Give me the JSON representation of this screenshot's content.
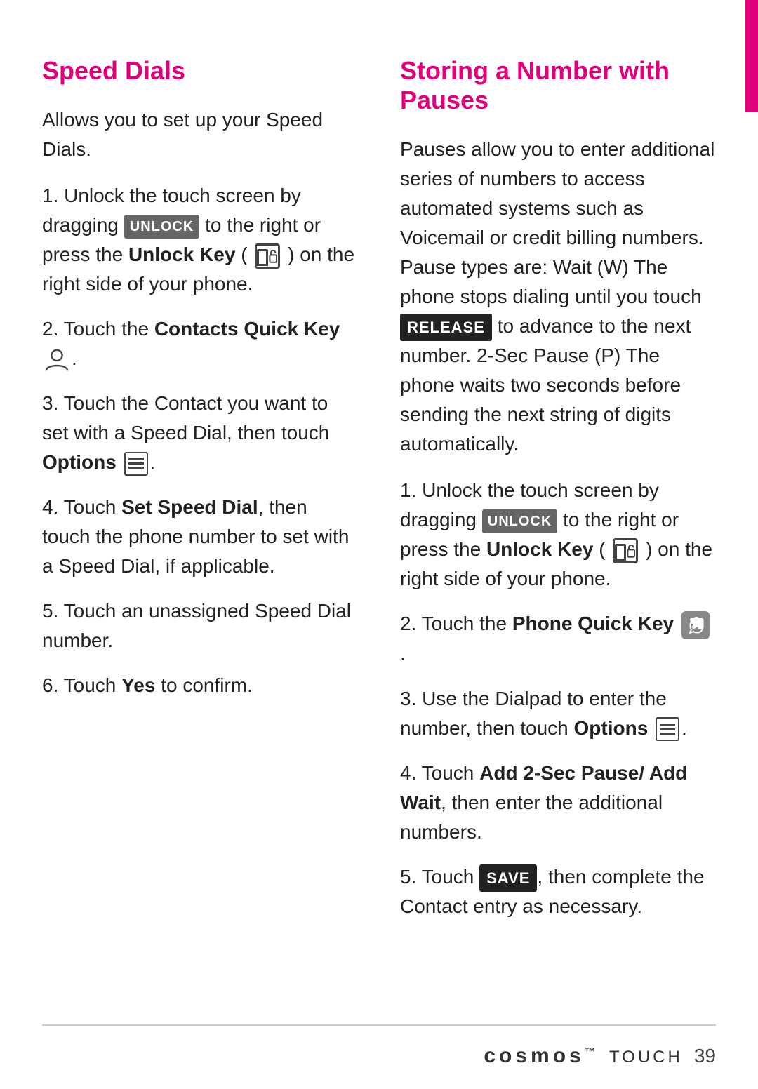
{
  "accent_bar": true,
  "left_column": {
    "heading": "Speed Dials",
    "intro": "Allows you to set up your Speed Dials.",
    "steps": [
      {
        "number": "1.",
        "text_parts": [
          {
            "type": "text",
            "content": "Unlock the touch screen by dragging "
          },
          {
            "type": "badge",
            "content": "UNLOCK",
            "style": "unlock"
          },
          {
            "type": "text",
            "content": " to the right or press the "
          },
          {
            "type": "bold",
            "content": "Unlock Key"
          },
          {
            "type": "text",
            "content": " ("
          },
          {
            "type": "icon",
            "content": "unlock-key"
          },
          {
            "type": "text",
            "content": ") on the right side of your phone."
          }
        ]
      },
      {
        "number": "2.",
        "text_parts": [
          {
            "type": "text",
            "content": "Touch the "
          },
          {
            "type": "bold",
            "content": "Contacts Quick Key"
          },
          {
            "type": "text",
            "content": " "
          },
          {
            "type": "icon",
            "content": "contacts"
          }
        ]
      },
      {
        "number": "3.",
        "text_parts": [
          {
            "type": "text",
            "content": "Touch the Contact you want to set with a Speed Dial, then touch "
          },
          {
            "type": "bold",
            "content": "Options"
          },
          {
            "type": "text",
            "content": " "
          },
          {
            "type": "icon",
            "content": "options"
          }
        ]
      },
      {
        "number": "4.",
        "text_parts": [
          {
            "type": "text",
            "content": "Touch "
          },
          {
            "type": "bold",
            "content": "Set Speed Dial"
          },
          {
            "type": "text",
            "content": ", then touch the phone number to set with a Speed Dial, if applicable."
          }
        ]
      },
      {
        "number": "5.",
        "text_parts": [
          {
            "type": "text",
            "content": "Touch an unassigned Speed Dial number."
          }
        ]
      },
      {
        "number": "6.",
        "text_parts": [
          {
            "type": "text",
            "content": "Touch "
          },
          {
            "type": "bold",
            "content": "Yes"
          },
          {
            "type": "text",
            "content": " to confirm."
          }
        ]
      }
    ]
  },
  "right_column": {
    "heading": "Storing a Number with Pauses",
    "intro": "Pauses allow you to enter additional series of numbers to access automated systems such as Voicemail or credit billing numbers. Pause types are: Wait (W) The phone stops dialing until you touch",
    "intro_release": "RELEASE",
    "intro_cont": "to advance to the next number. 2-Sec Pause (P) The phone waits two seconds before sending the next string of digits automatically.",
    "steps": [
      {
        "number": "1.",
        "text_parts": [
          {
            "type": "text",
            "content": "Unlock the touch screen by dragging "
          },
          {
            "type": "badge",
            "content": "UNLOCK",
            "style": "unlock"
          },
          {
            "type": "text",
            "content": " to the right or press the "
          },
          {
            "type": "bold",
            "content": "Unlock Key"
          },
          {
            "type": "text",
            "content": " ("
          },
          {
            "type": "icon",
            "content": "unlock-key"
          },
          {
            "type": "text",
            "content": ") on the right side of your phone."
          }
        ]
      },
      {
        "number": "2.",
        "text_parts": [
          {
            "type": "text",
            "content": "Touch the "
          },
          {
            "type": "bold",
            "content": "Phone Quick Key"
          },
          {
            "type": "text",
            "content": " "
          },
          {
            "type": "icon",
            "content": "phone"
          }
        ]
      },
      {
        "number": "3.",
        "text_parts": [
          {
            "type": "text",
            "content": "Use the Dialpad to enter the number, then touch "
          },
          {
            "type": "bold",
            "content": "Options"
          },
          {
            "type": "text",
            "content": " "
          },
          {
            "type": "icon",
            "content": "options"
          }
        ]
      },
      {
        "number": "4.",
        "text_parts": [
          {
            "type": "text",
            "content": "Touch "
          },
          {
            "type": "bold",
            "content": "Add 2-Sec Pause/ Add Wait"
          },
          {
            "type": "text",
            "content": ", then enter the additional numbers."
          }
        ]
      },
      {
        "number": "5.",
        "text_parts": [
          {
            "type": "text",
            "content": "Touch "
          },
          {
            "type": "badge",
            "content": "SAVE",
            "style": "save"
          },
          {
            "type": "text",
            "content": ", then complete the Contact entry as necessary."
          }
        ]
      }
    ]
  },
  "footer": {
    "brand": "cosmos",
    "product": "TOUCH",
    "page_number": "39"
  }
}
